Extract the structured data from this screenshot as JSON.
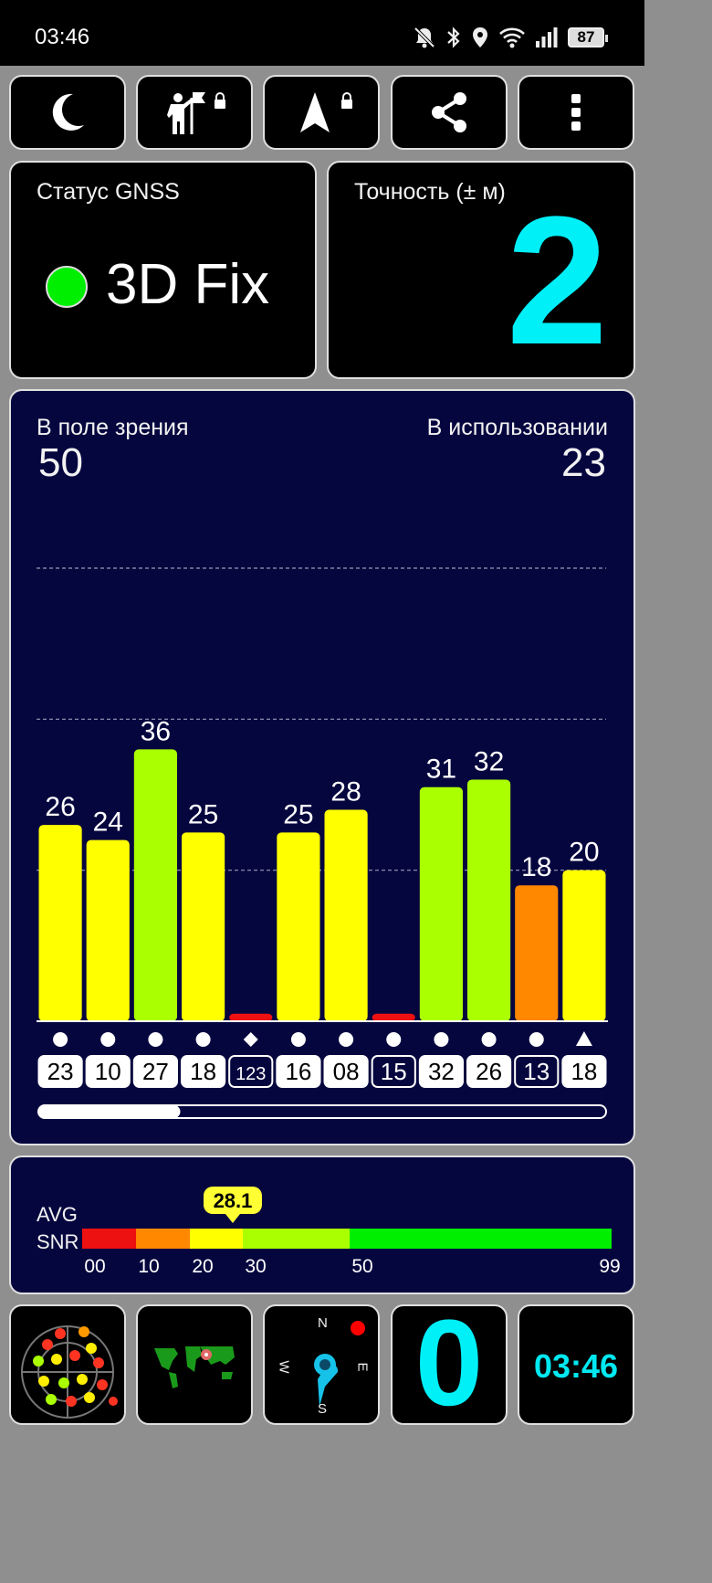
{
  "status_bar": {
    "time": "03:46",
    "battery": "87",
    "icons": [
      "bell-muted-icon",
      "bluetooth-icon",
      "location-pin-icon",
      "wifi-icon",
      "signal-icon",
      "battery-icon"
    ]
  },
  "toolbar": {
    "buttons": [
      {
        "name": "night-mode-button",
        "icon": "moon-icon"
      },
      {
        "name": "waypoint-button",
        "icon": "person-flag-icon",
        "locked": true
      },
      {
        "name": "navigation-button",
        "icon": "navigation-arrow-icon",
        "locked": true
      },
      {
        "name": "share-button",
        "icon": "share-icon"
      },
      {
        "name": "more-button",
        "icon": "more-vertical-icon"
      }
    ]
  },
  "gnss_status": {
    "label": "Статус GNSS",
    "value": "3D Fix",
    "indicator_color": "#00ee00"
  },
  "accuracy": {
    "label": "Точность (± м)",
    "value": "2",
    "color": "#00f0f8"
  },
  "satellites": {
    "in_view_label": "В поле зрения",
    "in_view": "50",
    "in_use_label": "В использовании",
    "in_use": "23",
    "scroll_fraction": 0.25,
    "scroll_position": 0
  },
  "chart_data": {
    "type": "bar",
    "title": "",
    "ylim": [
      0,
      60
    ],
    "gridlines": [
      20,
      40,
      60
    ],
    "bars": [
      {
        "snr": 26,
        "label": "26",
        "id": "23",
        "constellation": "circle",
        "used": true
      },
      {
        "snr": 24,
        "label": "24",
        "id": "10",
        "constellation": "circle",
        "used": true
      },
      {
        "snr": 36,
        "label": "36",
        "id": "27",
        "constellation": "circle",
        "used": true
      },
      {
        "snr": 25,
        "label": "25",
        "id": "18",
        "constellation": "circle",
        "used": true
      },
      {
        "snr": 1,
        "label": "",
        "id": "123",
        "constellation": "diamond",
        "used": false
      },
      {
        "snr": 25,
        "label": "25",
        "id": "16",
        "constellation": "circle",
        "used": true
      },
      {
        "snr": 28,
        "label": "28",
        "id": "08",
        "constellation": "circle",
        "used": true
      },
      {
        "snr": 1,
        "label": "",
        "id": "15",
        "constellation": "circle",
        "used": false
      },
      {
        "snr": 31,
        "label": "31",
        "id": "32",
        "constellation": "circle",
        "used": true
      },
      {
        "snr": 32,
        "label": "32",
        "id": "26",
        "constellation": "circle",
        "used": true
      },
      {
        "snr": 18,
        "label": "18",
        "id": "13",
        "constellation": "circle",
        "used": false
      },
      {
        "snr": 20,
        "label": "20",
        "id": "18",
        "constellation": "triangle",
        "used": true
      }
    ],
    "colors": {
      "bad": "#ee1111",
      "low": "#ff8800",
      "mid": "#ffff00",
      "good": "#aaff00",
      "great": "#00ee00"
    }
  },
  "avg_snr": {
    "label_line1": "AVG",
    "label_line2": "SNR",
    "value": "28.1",
    "value_num": 28.1,
    "ticks": [
      "00",
      "10",
      "20",
      "30",
      "50",
      "99"
    ],
    "segments": [
      {
        "from": 0,
        "to": 10,
        "color": "#ee1111"
      },
      {
        "from": 10,
        "to": 20,
        "color": "#ff8800"
      },
      {
        "from": 20,
        "to": 30,
        "color": "#ffff00"
      },
      {
        "from": 30,
        "to": 50,
        "color": "#aaff00"
      },
      {
        "from": 50,
        "to": 99,
        "color": "#00ee00"
      }
    ]
  },
  "bottom_bar": {
    "radar_icon": "sky-radar-icon",
    "map_icon": "world-map-icon",
    "compass": {
      "n": "N",
      "e": "E",
      "s": "S",
      "w": "W"
    },
    "counter": "0",
    "clock": "03:46"
  }
}
